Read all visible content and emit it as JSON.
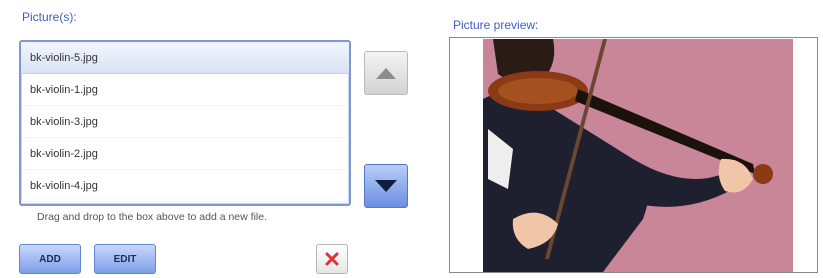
{
  "pictures_label": "Picture(s):",
  "preview_label": "Picture preview:",
  "files": [
    {
      "name": "bk-violin-5.jpg",
      "selected": true
    },
    {
      "name": "bk-violin-1.jpg",
      "selected": false
    },
    {
      "name": "bk-violin-3.jpg",
      "selected": false
    },
    {
      "name": "bk-violin-2.jpg",
      "selected": false
    },
    {
      "name": "bk-violin-4.jpg",
      "selected": false
    }
  ],
  "hint": "Drag and drop to the box above to add a new file.",
  "buttons": {
    "add": "ADD",
    "edit": "EDIT",
    "move_up_icon": "arrow-up-icon",
    "move_down_icon": "arrow-down-icon",
    "delete_icon": "delete-x-icon"
  },
  "colors": {
    "label": "#3d5fc0",
    "list_border": "#7f97cf",
    "button_blue": "#7d9ee8",
    "preview_background": "#c88698"
  }
}
